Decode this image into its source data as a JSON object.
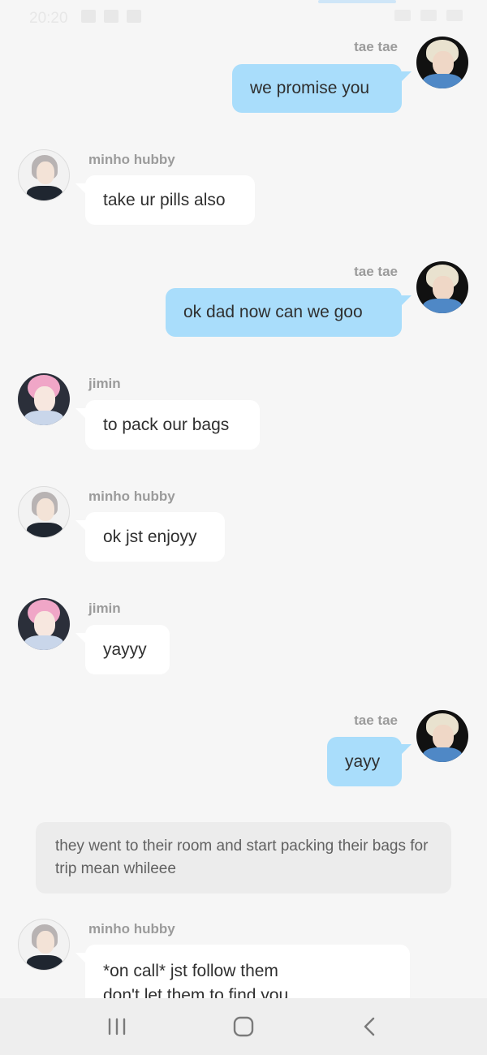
{
  "status_bar": {
    "time": "20:20"
  },
  "messages": [
    {
      "sender": "tae tae",
      "side": "me",
      "text": "we promise you"
    },
    {
      "sender": "minho hubby",
      "side": "other",
      "text": "take ur pills also"
    },
    {
      "sender": "tae tae",
      "side": "me",
      "text": "ok dad now can we goo"
    },
    {
      "sender": "jimin",
      "side": "other",
      "text": "to pack our bags"
    },
    {
      "sender": "minho hubby",
      "side": "other",
      "text": "ok jst enjoyy"
    },
    {
      "sender": "jimin",
      "side": "other",
      "text": "yayyy"
    },
    {
      "sender": "tae tae",
      "side": "me",
      "text": "yayy"
    },
    {
      "sender": "minho hubby",
      "side": "other",
      "text": "*on call* jst follow them",
      "text_line2": "don't let them to find you"
    }
  ],
  "narration": {
    "text": "they went to their room and start packing their bags for trip mean whileee"
  },
  "colors": {
    "my_bubble": "#a9ddfb",
    "other_bubble": "#ffffff",
    "background": "#f6f6f6",
    "narration_bg": "#ececec"
  },
  "navbar": {
    "icons": [
      "recent-apps-icon",
      "home-icon",
      "back-icon"
    ]
  }
}
